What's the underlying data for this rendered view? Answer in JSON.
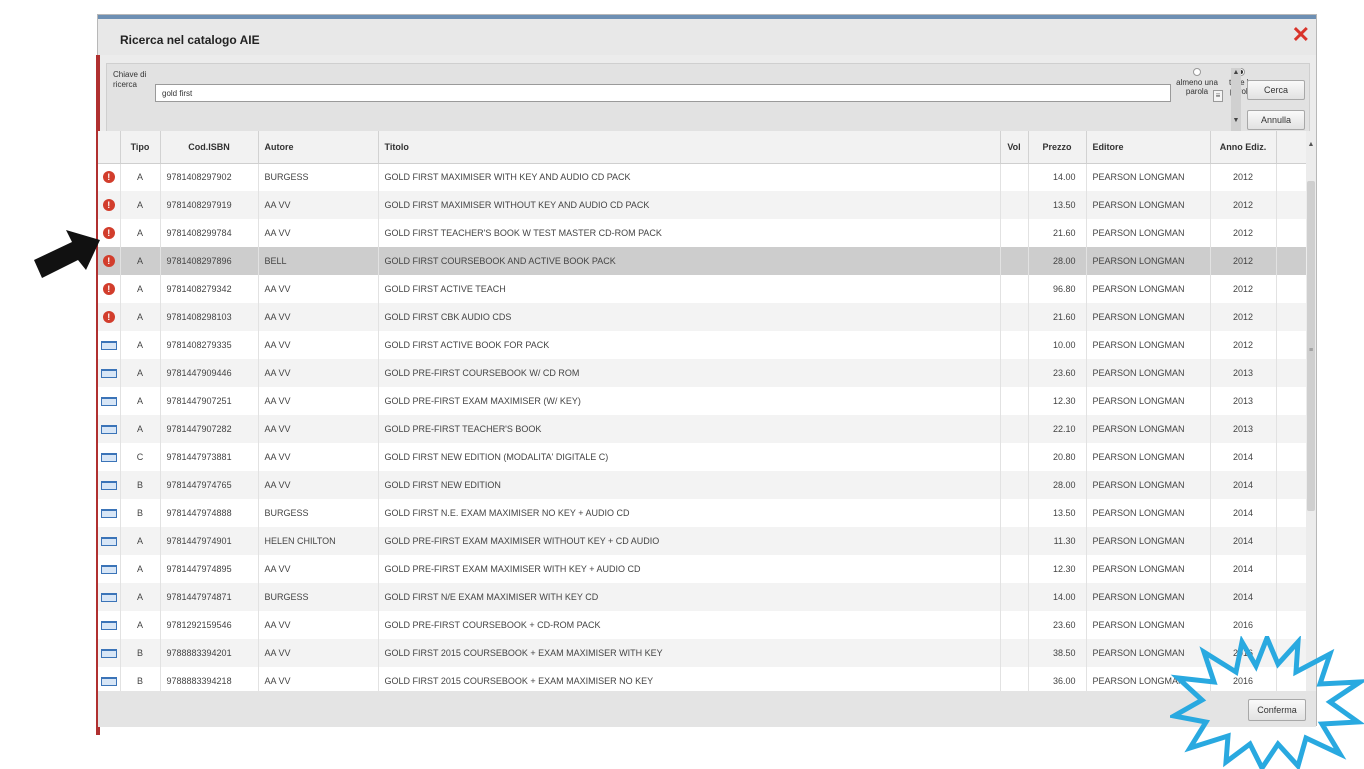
{
  "dialog": {
    "title": "Ricerca nel catalogo AIE",
    "close_symbol": "✕"
  },
  "search": {
    "label": "Chiave di ricerca",
    "value": "gold first",
    "options": [
      {
        "label": "almeno una parola",
        "selected": false
      },
      {
        "label": "tutte le parole",
        "selected": true
      }
    ],
    "search_button": "Cerca",
    "cancel_button": "Annulla"
  },
  "table": {
    "columns": [
      "Tipo",
      "Cod.ISBN",
      "Autore",
      "Titolo",
      "Vol",
      "Prezzo",
      "Editore",
      "Anno Ediz."
    ],
    "rows": [
      {
        "icon": "warning-icon",
        "tipo": "A",
        "isbn": "9781408297902",
        "autore": "BURGESS",
        "titolo": "GOLD FIRST MAXIMISER WITH KEY AND AUDIO CD PACK",
        "vol": "",
        "prezzo": "14.00",
        "editore": "PEARSON LONGMAN",
        "anno": "2012"
      },
      {
        "icon": "warning-icon",
        "tipo": "A",
        "isbn": "9781408297919",
        "autore": "AA VV",
        "titolo": "GOLD FIRST MAXIMISER WITHOUT KEY AND AUDIO CD PACK",
        "vol": "",
        "prezzo": "13.50",
        "editore": "PEARSON LONGMAN",
        "anno": "2012"
      },
      {
        "icon": "warning-icon",
        "tipo": "A",
        "isbn": "9781408299784",
        "autore": "AA VV",
        "titolo": "GOLD FIRST TEACHER'S BOOK W TEST MASTER CD-ROM PACK",
        "vol": "",
        "prezzo": "21.60",
        "editore": "PEARSON LONGMAN",
        "anno": "2012"
      },
      {
        "icon": "warning-icon",
        "tipo": "A",
        "isbn": "9781408297896",
        "autore": "BELL",
        "titolo": "GOLD FIRST COURSEBOOK AND ACTIVE BOOK PACK",
        "vol": "",
        "prezzo": "28.00",
        "editore": "PEARSON LONGMAN",
        "anno": "2012"
      },
      {
        "icon": "warning-icon",
        "tipo": "A",
        "isbn": "9781408279342",
        "autore": "AA VV",
        "titolo": "GOLD FIRST ACTIVE TEACH",
        "vol": "",
        "prezzo": "96.80",
        "editore": "PEARSON LONGMAN",
        "anno": "2012"
      },
      {
        "icon": "warning-icon",
        "tipo": "A",
        "isbn": "9781408298103",
        "autore": "AA VV",
        "titolo": "GOLD FIRST CBK AUDIO CDS",
        "vol": "",
        "prezzo": "21.60",
        "editore": "PEARSON LONGMAN",
        "anno": "2012"
      },
      {
        "icon": "book-icon",
        "tipo": "A",
        "isbn": "9781408279335",
        "autore": "AA VV",
        "titolo": "GOLD FIRST ACTIVE BOOK FOR PACK",
        "vol": "",
        "prezzo": "10.00",
        "editore": "PEARSON LONGMAN",
        "anno": "2012"
      },
      {
        "icon": "book-icon",
        "tipo": "A",
        "isbn": "9781447909446",
        "autore": "AA VV",
        "titolo": "GOLD PRE-FIRST COURSEBOOK W/ CD ROM",
        "vol": "",
        "prezzo": "23.60",
        "editore": "PEARSON LONGMAN",
        "anno": "2013"
      },
      {
        "icon": "book-icon",
        "tipo": "A",
        "isbn": "9781447907251",
        "autore": "AA VV",
        "titolo": "GOLD PRE-FIRST EXAM MAXIMISER (W/ KEY)",
        "vol": "",
        "prezzo": "12.30",
        "editore": "PEARSON LONGMAN",
        "anno": "2013"
      },
      {
        "icon": "book-icon",
        "tipo": "A",
        "isbn": "9781447907282",
        "autore": "AA VV",
        "titolo": "GOLD PRE-FIRST TEACHER'S BOOK",
        "vol": "",
        "prezzo": "22.10",
        "editore": "PEARSON LONGMAN",
        "anno": "2013"
      },
      {
        "icon": "book-icon",
        "tipo": "C",
        "isbn": "9781447973881",
        "autore": "AA VV",
        "titolo": "GOLD FIRST NEW EDITION (MODALITA' DIGITALE C)",
        "vol": "",
        "prezzo": "20.80",
        "editore": "PEARSON LONGMAN",
        "anno": "2014"
      },
      {
        "icon": "book-icon",
        "tipo": "B",
        "isbn": "9781447974765",
        "autore": "AA VV",
        "titolo": "GOLD FIRST NEW EDITION",
        "vol": "",
        "prezzo": "28.00",
        "editore": "PEARSON LONGMAN",
        "anno": "2014"
      },
      {
        "icon": "book-icon",
        "tipo": "B",
        "isbn": "9781447974888",
        "autore": "BURGESS",
        "titolo": "GOLD FIRST N.E. EXAM MAXIMISER NO KEY + AUDIO CD",
        "vol": "",
        "prezzo": "13.50",
        "editore": "PEARSON LONGMAN",
        "anno": "2014"
      },
      {
        "icon": "book-icon",
        "tipo": "A",
        "isbn": "9781447974901",
        "autore": "HELEN CHILTON",
        "titolo": "GOLD PRE-FIRST EXAM MAXIMISER WITHOUT KEY + CD AUDIO",
        "vol": "",
        "prezzo": "11.30",
        "editore": "PEARSON LONGMAN",
        "anno": "2014"
      },
      {
        "icon": "book-icon",
        "tipo": "A",
        "isbn": "9781447974895",
        "autore": "AA VV",
        "titolo": "GOLD PRE-FIRST EXAM MAXIMISER WITH KEY + AUDIO CD",
        "vol": "",
        "prezzo": "12.30",
        "editore": "PEARSON LONGMAN",
        "anno": "2014"
      },
      {
        "icon": "book-icon",
        "tipo": "A",
        "isbn": "9781447974871",
        "autore": "BURGESS",
        "titolo": "GOLD FIRST N/E EXAM MAXIMISER WITH KEY CD",
        "vol": "",
        "prezzo": "14.00",
        "editore": "PEARSON LONGMAN",
        "anno": "2014"
      },
      {
        "icon": "book-icon",
        "tipo": "A",
        "isbn": "9781292159546",
        "autore": "AA VV",
        "titolo": "GOLD PRE-FIRST COURSEBOOK + CD-ROM PACK",
        "vol": "",
        "prezzo": "23.60",
        "editore": "PEARSON LONGMAN",
        "anno": "2016"
      },
      {
        "icon": "book-icon",
        "tipo": "B",
        "isbn": "9788883394201",
        "autore": "AA VV",
        "titolo": "GOLD FIRST 2015 COURSEBOOK + EXAM MAXIMISER WITH KEY",
        "vol": "",
        "prezzo": "38.50",
        "editore": "PEARSON LONGMAN",
        "anno": "2016"
      },
      {
        "icon": "book-icon",
        "tipo": "B",
        "isbn": "9788883394218",
        "autore": "AA VV",
        "titolo": "GOLD FIRST 2015 COURSEBOOK + EXAM MAXIMISER NO KEY",
        "vol": "",
        "prezzo": "36.00",
        "editore": "PEARSON LONGMAN",
        "anno": "2016"
      }
    ],
    "selected_row": 3
  },
  "footer": {
    "confirm_button": "Conferma"
  },
  "colors": {
    "warning": "#d23d2c",
    "book": "#3b74b8",
    "callout_star": "#29a9e0",
    "close": "#d9342b"
  }
}
